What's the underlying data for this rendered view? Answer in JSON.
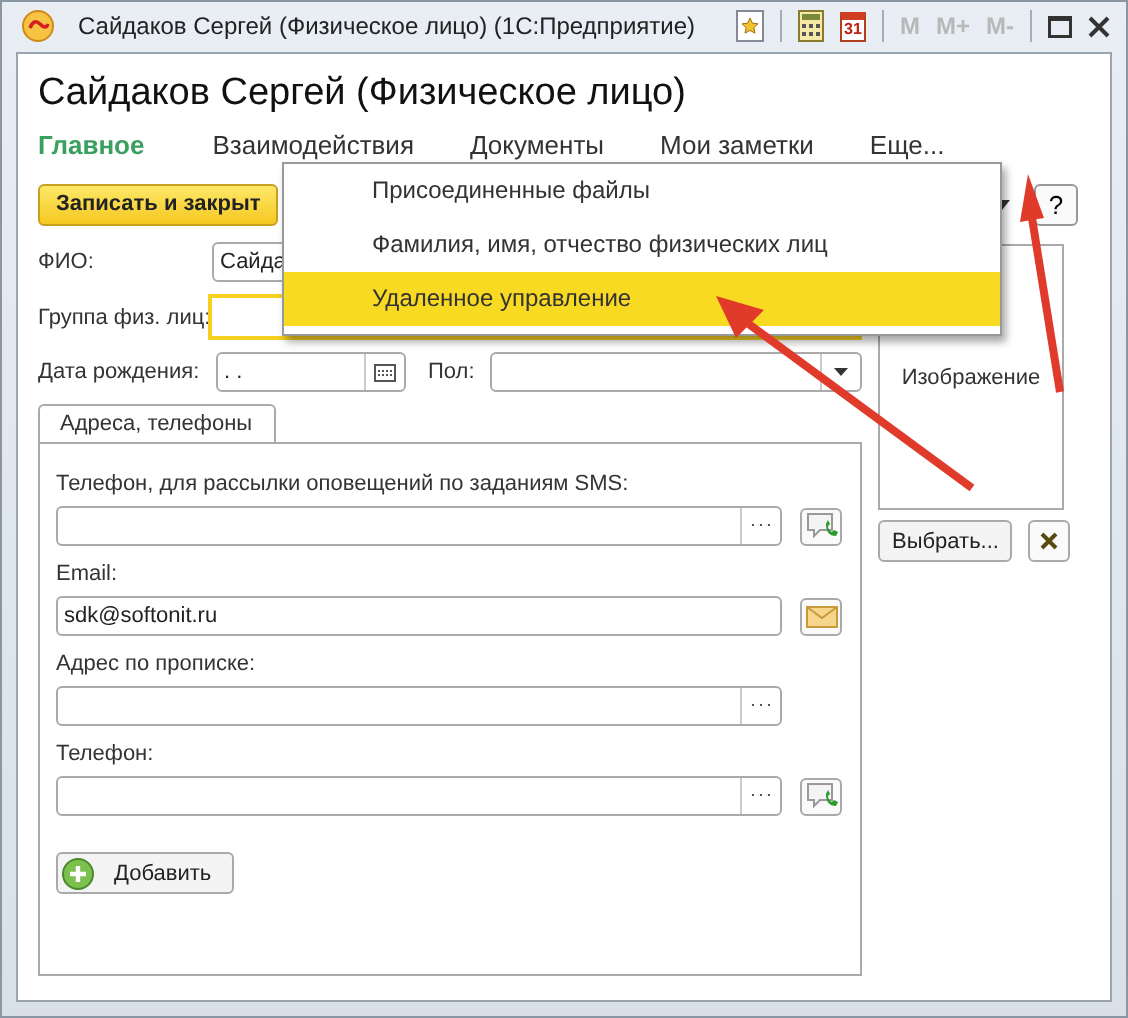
{
  "window": {
    "title": "Сайдаков Сергей (Физическое лицо)  (1С:Предприятие)",
    "calendar_day": "31",
    "memory_buttons": [
      {
        "label": "M",
        "disabled": true
      },
      {
        "label": "M+",
        "disabled": true
      },
      {
        "label": "M-",
        "disabled": true
      }
    ]
  },
  "heading": "Сайдаков Сергей (Физическое лицо)",
  "nav": [
    {
      "label": "Главное",
      "selected": true
    },
    {
      "label": "Взаимодействия",
      "selected": false
    },
    {
      "label": "Документы",
      "selected": false
    },
    {
      "label": "Мои заметки",
      "selected": false
    },
    {
      "label": "Еще...",
      "selected": false
    }
  ],
  "toolbar": {
    "save_button": "Записать и закрыт",
    "help_button": "?"
  },
  "form": {
    "fio": {
      "label": "ФИО:",
      "value": "Сайда"
    },
    "group": {
      "label": "Группа физ. лиц:",
      "focused": true
    },
    "birth_date": {
      "label": "Дата рождения:",
      "value": ". ."
    },
    "gender": {
      "label": "Пол:"
    }
  },
  "image": {
    "placeholder": "Изображение",
    "select_button": "Выбрать..."
  },
  "tabs": [
    {
      "label": "Адреса, телефоны",
      "selected": true
    }
  ],
  "contacts": [
    {
      "kind": "phone",
      "label": "Телефон, для рассылки оповещений по заданиям SMS:"
    },
    {
      "kind": "email",
      "label": "Email:",
      "value": "sdk@softonit.ru"
    },
    {
      "kind": "address",
      "label": "Адрес по прописке:"
    },
    {
      "kind": "phone",
      "label": "Телефон:"
    }
  ],
  "add_button": "Добавить",
  "menu": {
    "items": [
      {
        "label": "Присоединенные файлы",
        "selected": false
      },
      {
        "label": "Фамилия, имя, отчество физических лиц",
        "selected": false
      },
      {
        "label": "Удаленное управление",
        "selected": true
      }
    ]
  }
}
